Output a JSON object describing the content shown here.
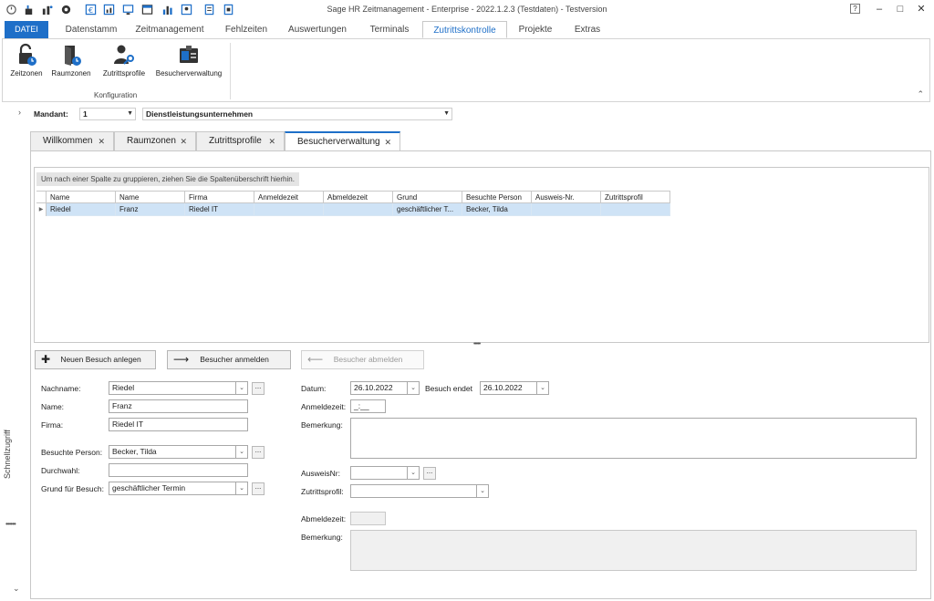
{
  "app_title": "Sage HR Zeitmanagement - Enterprise - 2022.1.2.3 (Testdaten) - Testversion",
  "quick_access_icons": [
    "refresh-icon",
    "robot-icon",
    "chart-person-icon",
    "gear-icon",
    "currency-icon",
    "chart-icon",
    "monitor-icon",
    "calendar-icon",
    "bar-chart-icon",
    "person-chart-icon",
    "report-icon",
    "export-icon"
  ],
  "window_controls": {
    "help": "?",
    "minimize": "–",
    "maximize": "□",
    "close": "✕"
  },
  "ribbon_tabs": [
    {
      "label": "DATEI"
    },
    {
      "label": "Datenstamm"
    },
    {
      "label": "Zeitmanagement"
    },
    {
      "label": "Fehlzeiten"
    },
    {
      "label": "Auswertungen"
    },
    {
      "label": "Terminals"
    },
    {
      "label": "Zutrittskontrolle"
    },
    {
      "label": "Projekte"
    },
    {
      "label": "Extras"
    }
  ],
  "ribbon_buttons": [
    {
      "label": "Zeitzonen",
      "icon": "lock-clock-icon"
    },
    {
      "label": "Raumzonen",
      "icon": "door-clock-icon"
    },
    {
      "label": "Zutrittsprofile",
      "icon": "person-key-icon"
    },
    {
      "label": "Besucherverwaltung",
      "icon": "visitor-badge-icon"
    }
  ],
  "ribbon_group_label": "Konfiguration",
  "mandant": {
    "label": "Mandant:",
    "number": "1",
    "name": "Dienstleistungsunternehmen"
  },
  "quick_access_label": "Schnellzugriff",
  "doc_tabs": [
    {
      "label": "Willkommen"
    },
    {
      "label": "Raumzonen"
    },
    {
      "label": "Zutrittsprofile"
    },
    {
      "label": "Besucherverwaltung"
    }
  ],
  "grid": {
    "group_hint": "Um nach einer Spalte zu gruppieren, ziehen Sie die Spaltenüberschrift hierhin.",
    "columns": [
      "Name",
      "Name",
      "Firma",
      "Anmeldezeit",
      "Abmeldezeit",
      "Grund",
      "Besuchte Person",
      "Ausweis-Nr.",
      "Zutrittsprofil"
    ],
    "rows": [
      [
        "Riedel",
        "Franz",
        "Riedel IT",
        "",
        "",
        "geschäftlicher T...",
        "Becker, Tilda",
        "",
        ""
      ]
    ]
  },
  "actions": {
    "new_visit": "Neuen Besuch anlegen",
    "register": "Besucher anmelden",
    "unregister": "Besucher abmelden"
  },
  "form": {
    "nachname_label": "Nachname:",
    "nachname_value": "Riedel",
    "name_label": "Name:",
    "name_value": "Franz",
    "firma_label": "Firma:",
    "firma_value": "Riedel IT",
    "besuchte_person_label": "Besuchte Person:",
    "besuchte_person_value": "Becker, Tilda",
    "durchwahl_label": "Durchwahl:",
    "durchwahl_value": "",
    "grund_label": "Grund für Besuch:",
    "grund_value": "geschäftlicher Termin",
    "datum_label": "Datum:",
    "datum_value": "26.10.2022",
    "besuch_endet_label": "Besuch endet",
    "besuch_endet_value": "26.10.2022",
    "anmeldezeit_label": "Anmeldezeit:",
    "anmeldezeit_value": "_:__",
    "bemerkung_label": "Bemerkung:",
    "ausweisnr_label": "AusweisNr:",
    "zutrittsprofil_label": "Zutrittsprofil:",
    "abmeldezeit_label": "Abmeldezeit:",
    "bemerkung2_label": "Bemerkung:"
  },
  "colors": {
    "accent": "#1e6fc8",
    "selected_row": "#cfe3f6"
  }
}
